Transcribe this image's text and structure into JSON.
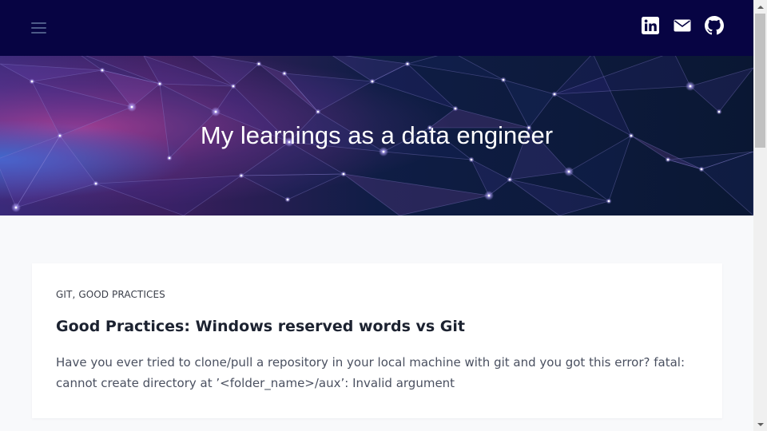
{
  "header": {
    "background_color": "#070443",
    "menu_icon": "hamburger-menu-icon",
    "social_links": [
      {
        "icon": "linkedin-icon"
      },
      {
        "icon": "mail-icon"
      },
      {
        "icon": "github-icon"
      }
    ]
  },
  "hero": {
    "title": "My learnings as a data engineer",
    "background": "network-constellation-image"
  },
  "posts": [
    {
      "tags": [
        "GIT",
        "GOOD PRACTICES"
      ],
      "tag_separator": ", ",
      "title": "Good Practices: Windows reserved words vs Git",
      "excerpt": "Have you ever tried to clone/pull a repository in your local machine with git and you got this error? fatal: cannot create directory at ’<folder_name>/aux’: Invalid argument"
    }
  ],
  "colors": {
    "page_background": "#f8f9fb",
    "card_background": "#ffffff",
    "title_text": "#1c2230",
    "body_text": "#4a5060"
  }
}
